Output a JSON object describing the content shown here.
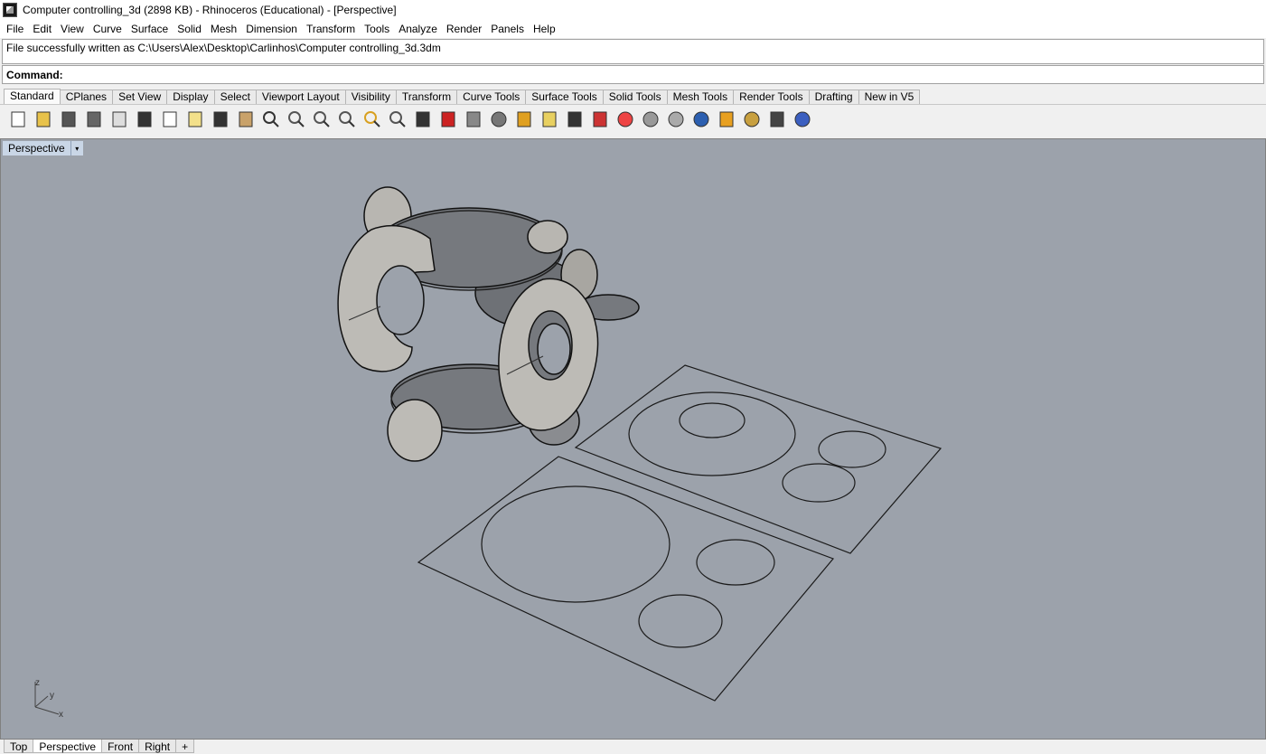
{
  "window": {
    "title": "Computer controlling_3d (2898 KB) - Rhinoceros (Educational) - [Perspective]"
  },
  "menu": [
    "File",
    "Edit",
    "View",
    "Curve",
    "Surface",
    "Solid",
    "Mesh",
    "Dimension",
    "Transform",
    "Tools",
    "Analyze",
    "Render",
    "Panels",
    "Help"
  ],
  "history": {
    "line": "File successfully written as C:\\Users\\Alex\\Desktop\\Carlinhos\\Computer controlling_3d.3dm"
  },
  "command": {
    "label": "Command:",
    "value": ""
  },
  "toolbar_tabs": [
    "Standard",
    "CPlanes",
    "Set View",
    "Display",
    "Select",
    "Viewport Layout",
    "Visibility",
    "Transform",
    "Curve Tools",
    "Surface Tools",
    "Solid Tools",
    "Mesh Tools",
    "Render Tools",
    "Drafting",
    "New in V5"
  ],
  "toolbar_icons": [
    "new-file-icon",
    "open-folder-icon",
    "save-icon",
    "print-icon",
    "import-icon",
    "cut-icon",
    "copy-icon",
    "paste-icon",
    "undo-icon",
    "pan-hand-icon",
    "rotate-view-icon",
    "zoom-icon",
    "zoom-window-icon",
    "zoom-extents-icon",
    "zoom-selected-icon",
    "undo-view-icon",
    "viewport-layout-icon",
    "car-icon",
    "select-filter-icon",
    "point-icon",
    "cplane-icon",
    "lightbulb-icon",
    "lock-icon",
    "layer-icon",
    "color-wheel-icon",
    "shaded-sphere-icon",
    "rendered-sphere-icon",
    "blue-sphere-icon",
    "flag-icon",
    "settings-gear-icon",
    "snap-icon",
    "help-icon"
  ],
  "viewport": {
    "label": "Perspective",
    "dropdown_glyph": "▾",
    "axis_labels": {
      "z": "z",
      "y": "y",
      "x": "x"
    }
  },
  "view_tabs": [
    "Top",
    "Perspective",
    "Front",
    "Right",
    "+"
  ],
  "colors": {
    "viewport_bg": "#9ca2ab",
    "shaded_part": "#bebcb7",
    "dark_part": "#73767b"
  }
}
